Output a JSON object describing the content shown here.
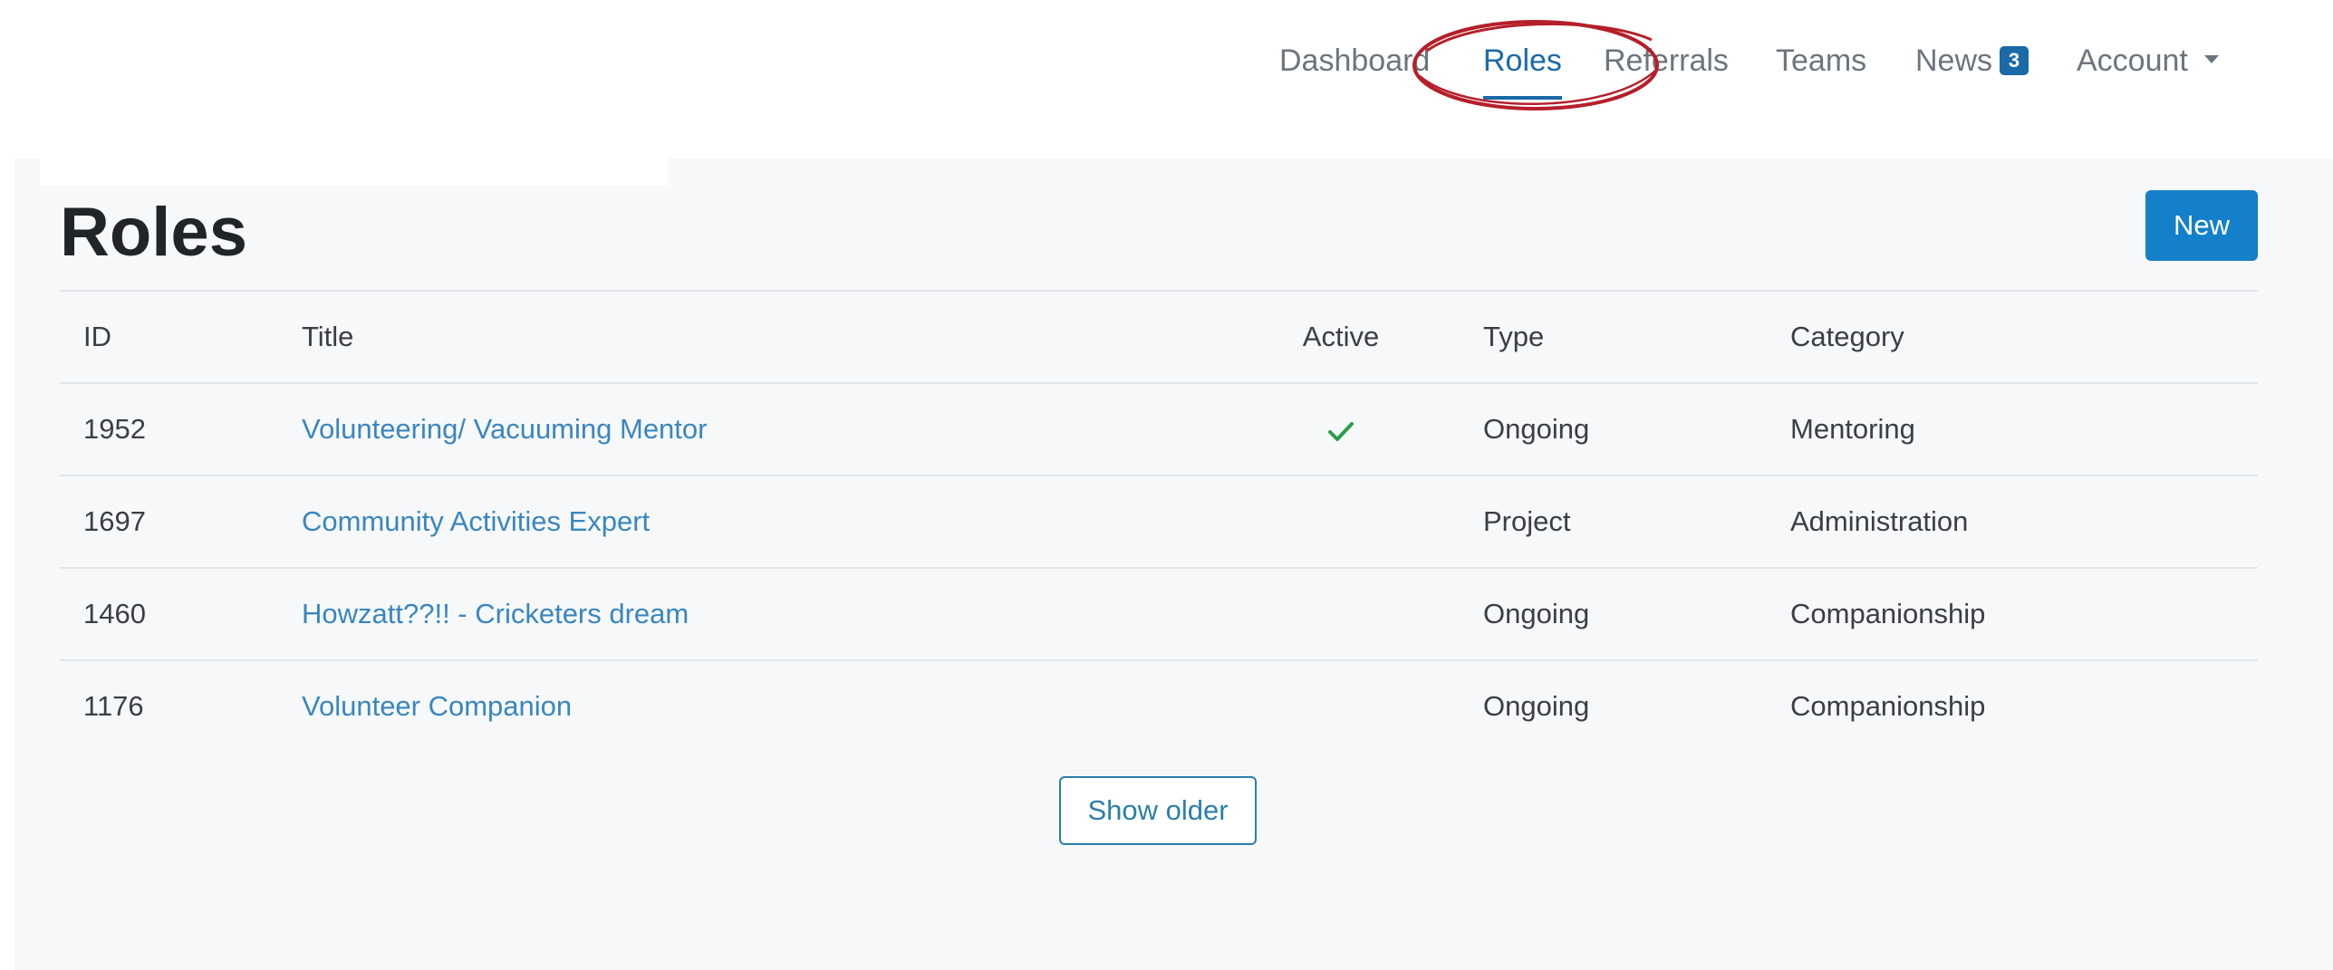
{
  "nav": {
    "items": [
      {
        "label": "Dashboard",
        "active": false
      },
      {
        "label": "Roles",
        "active": true
      },
      {
        "label": "Referrals",
        "active": false
      },
      {
        "label": "Teams",
        "active": false
      },
      {
        "label": "News",
        "active": false,
        "badge": "3"
      },
      {
        "label": "Account",
        "active": false,
        "icon": "caret-down-icon"
      }
    ]
  },
  "colors": {
    "accent": "#1a6aa8",
    "new_button": "#1480c9",
    "link": "#3a86bf",
    "check": "#2e9e4a",
    "annotation": "#b51f2a",
    "panel_background": "#f6f8f9"
  },
  "page": {
    "title": "Roles",
    "new_label": "New"
  },
  "table": {
    "columns": [
      "ID",
      "Title",
      "Active",
      "Type",
      "Category"
    ],
    "rows": [
      {
        "id": "1952",
        "title": "Volunteering/ Vacuuming Mentor",
        "active": true,
        "type": "Ongoing",
        "category": "Mentoring"
      },
      {
        "id": "1697",
        "title": "Community Activities Expert",
        "active": false,
        "type": "Project",
        "category": "Administration"
      },
      {
        "id": "1460",
        "title": "Howzatt??!! - Cricketers dream",
        "active": false,
        "type": "Ongoing",
        "category": "Companionship"
      },
      {
        "id": "1176",
        "title": "Volunteer Companion",
        "active": false,
        "type": "Ongoing",
        "category": "Companionship"
      }
    ]
  },
  "pagination": {
    "show_older_label": "Show older"
  }
}
